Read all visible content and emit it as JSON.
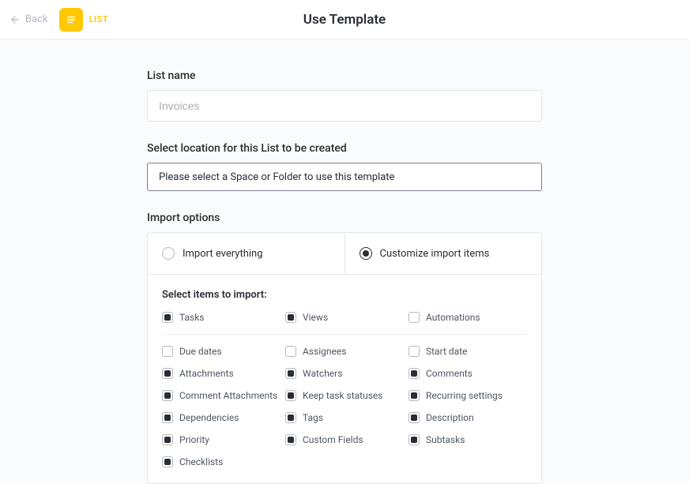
{
  "header": {
    "back_label": "Back",
    "badge_label": "LIST",
    "page_title": "Use Template"
  },
  "list_name": {
    "label": "List name",
    "placeholder": "Invoices",
    "value": ""
  },
  "location": {
    "label": "Select location for this List to be created",
    "placeholder": "Please select a Space or Folder to use this template"
  },
  "import": {
    "label": "Import options",
    "radio_everything": "Import everything",
    "radio_customize": "Customize import items",
    "selected": "customize",
    "heading": "Select items to import:",
    "group_top": [
      {
        "label": "Tasks",
        "checked": true
      },
      {
        "label": "Views",
        "checked": true
      },
      {
        "label": "Automations",
        "checked": false
      }
    ],
    "group_rest": [
      {
        "label": "Due dates",
        "checked": false
      },
      {
        "label": "Assignees",
        "checked": false
      },
      {
        "label": "Start date",
        "checked": false
      },
      {
        "label": "Attachments",
        "checked": true
      },
      {
        "label": "Watchers",
        "checked": true
      },
      {
        "label": "Comments",
        "checked": true
      },
      {
        "label": "Comment Attachments",
        "checked": true
      },
      {
        "label": "Keep task statuses",
        "checked": true
      },
      {
        "label": "Recurring settings",
        "checked": true
      },
      {
        "label": "Dependencies",
        "checked": true
      },
      {
        "label": "Tags",
        "checked": true
      },
      {
        "label": "Description",
        "checked": true
      },
      {
        "label": "Priority",
        "checked": true
      },
      {
        "label": "Custom Fields",
        "checked": true
      },
      {
        "label": "Subtasks",
        "checked": true
      },
      {
        "label": "Checklists",
        "checked": true
      }
    ]
  }
}
